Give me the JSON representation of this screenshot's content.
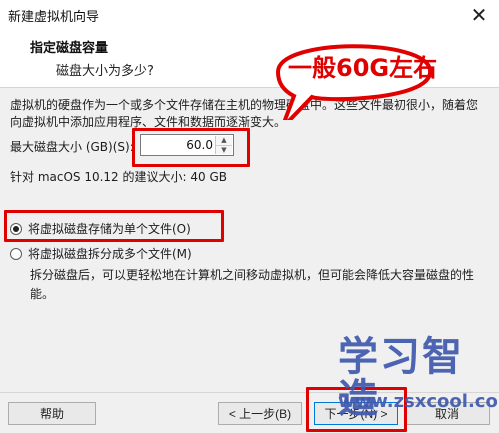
{
  "window": {
    "title": "新建虚拟机向导",
    "close_icon": "close-icon"
  },
  "header": {
    "title": "指定磁盘容量",
    "subtitle": "磁盘大小为多少?"
  },
  "content": {
    "description": "虚拟机的硬盘作为一个或多个文件存储在主机的物理磁盘中。这些文件最初很小，随着您向虚拟机中添加应用程序、文件和数据而逐渐变大。",
    "max_size_label": "最大磁盘大小 (GB)(S):",
    "max_size_value": "60.0",
    "recommend_text": "针对 macOS 10.12 的建议大小: 40 GB",
    "option_single_label": "将虚拟磁盘存储为单个文件(O)",
    "option_multiple_label": "将虚拟磁盘拆分成多个文件(M)",
    "multiple_description": "拆分磁盘后，可以更轻松地在计算机之间移动虚拟机，但可能会降低大容量磁盘的性能。",
    "selected_option": "single"
  },
  "buttons": {
    "help": "帮助",
    "back": "< 上一步(B)",
    "next": "下一步(N) >",
    "cancel": "取消"
  },
  "annotation": {
    "callout_text": "一般60G左右",
    "highlight_color": "#e00000"
  },
  "watermark": {
    "text_large": "学习智造",
    "text_small": "www.zsxcool.com",
    "color": "#3f59ad"
  }
}
